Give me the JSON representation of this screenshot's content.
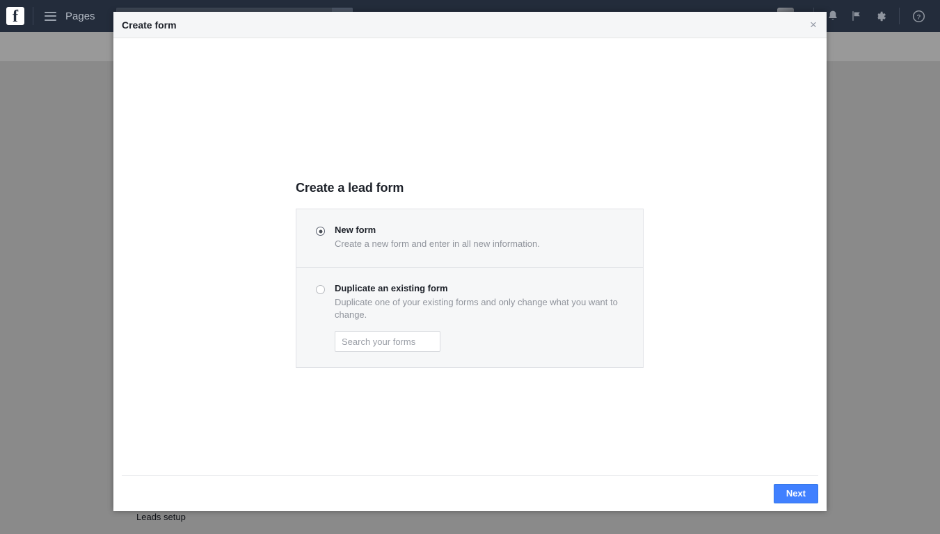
{
  "topbar": {
    "logo_icon": "facebook-logo-icon",
    "menu_icon": "hamburger-menu-icon",
    "nav_label": "Pages",
    "search_placeholder": "",
    "search_icon": "search-icon",
    "profile_name": "",
    "icons": {
      "notifications": "bell-icon",
      "flag": "flag-icon",
      "settings": "gear-icon",
      "help": "help-circle-icon"
    }
  },
  "background_page": {
    "leads_setup_label": "Leads setup"
  },
  "modal": {
    "title": "Create form",
    "close_label": "×",
    "heading": "Create a lead form",
    "options": [
      {
        "label": "New form",
        "description": "Create a new form and enter in all new information.",
        "selected": true
      },
      {
        "label": "Duplicate an existing form",
        "description": "Duplicate one of your existing forms and only change what you want to change.",
        "selected": false,
        "search_placeholder": "Search your forms",
        "search_value": ""
      }
    ],
    "footer": {
      "next_label": "Next"
    }
  },
  "colors": {
    "nav_background": "#232c3b",
    "accent_button": "#4080ff",
    "panel_background": "#f6f7f8",
    "text_primary": "#1d2129",
    "text_secondary": "#90949c"
  }
}
